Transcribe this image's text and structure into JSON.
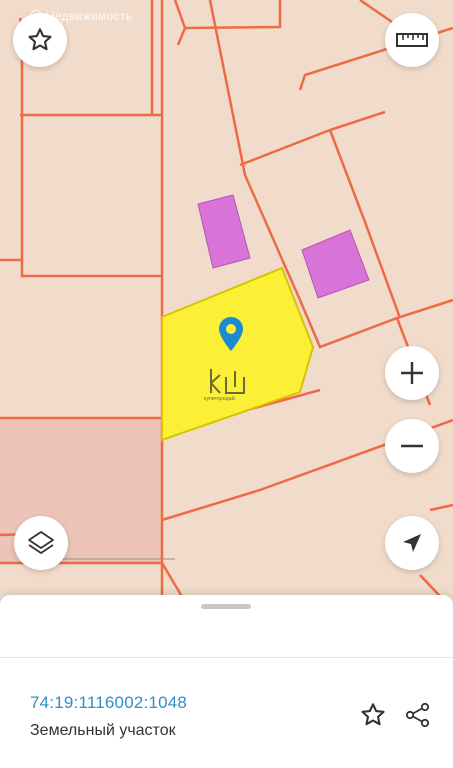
{
  "map": {
    "watermark": "Недвижимость",
    "brand_text": "купи•продай",
    "colors": {
      "background": "#f1dccb",
      "parcel_border": "#ee6a45",
      "selected_fill": "#fbf036",
      "selected_stroke": "#d9c200",
      "building_fill": "#d873d8",
      "building_stroke": "#b555b5",
      "pin": "#1b8ad1"
    },
    "buttons": {
      "favorite_icon": "star-outline-icon",
      "ruler_icon": "ruler-icon",
      "zoom_in_icon": "plus-icon",
      "zoom_out_icon": "minus-icon",
      "layers_icon": "layers-icon",
      "locate_icon": "navigation-arrow-icon"
    }
  },
  "sheet": {
    "cadastral_number": "74:19:1116002:1048",
    "parcel_type": "Земельный участок",
    "actions": {
      "favorite_icon": "star-outline-icon",
      "share_icon": "share-icon"
    }
  }
}
